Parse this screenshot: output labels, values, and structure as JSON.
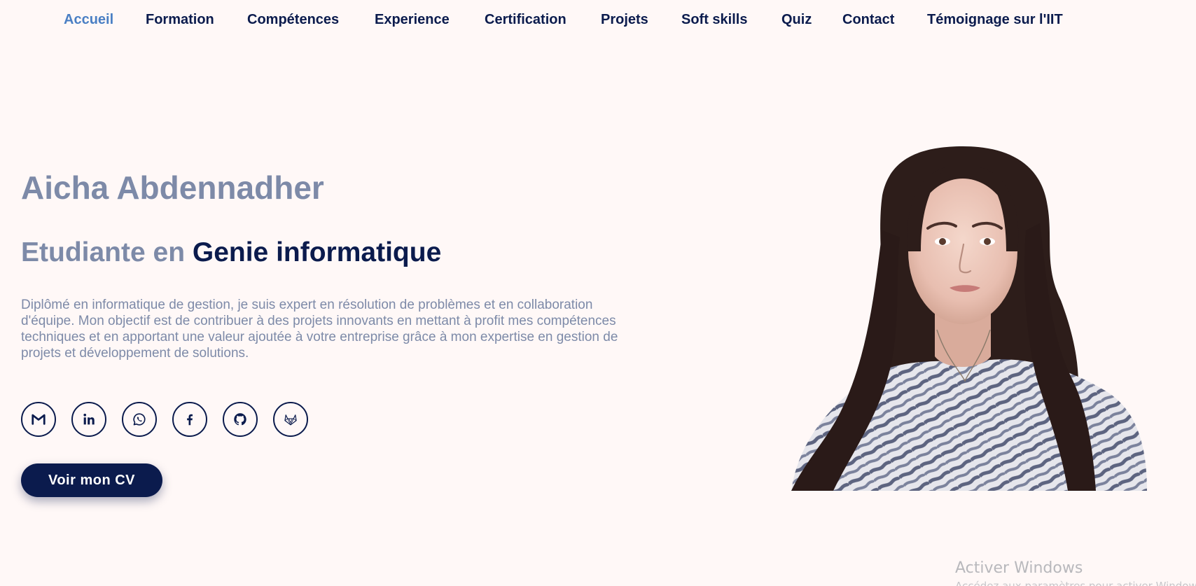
{
  "nav": {
    "items": [
      {
        "label": "Accueil",
        "active": true
      },
      {
        "label": "Formation"
      },
      {
        "label": "Compétences"
      },
      {
        "label": "Experience"
      },
      {
        "label": "Certification"
      },
      {
        "label": "Projets"
      },
      {
        "label": "Soft skills"
      },
      {
        "label": "Quiz"
      },
      {
        "label": "Contact"
      },
      {
        "label": "Témoignage sur l'IIT"
      }
    ]
  },
  "hero": {
    "name": "Aicha Abdennadher",
    "subtitle_prefix": "Etudiante en",
    "subtitle_field": "Genie informatique",
    "description": "Diplômé en informatique de gestion, je suis expert en résolution de problèmes et en collaboration d'équipe. Mon objectif est de contribuer à des projets innovants en mettant à profit mes compétences techniques et en apportant une valeur ajoutée à votre entreprise grâce à mon expertise en gestion de projets et développement de solutions.",
    "socials": [
      {
        "icon": "gmail-icon"
      },
      {
        "icon": "linkedin-icon"
      },
      {
        "icon": "whatsapp-icon"
      },
      {
        "icon": "facebook-icon"
      },
      {
        "icon": "github-icon"
      },
      {
        "icon": "gitlab-icon"
      }
    ],
    "cv_button": "Voir mon CV",
    "portrait": "portrait-photo"
  },
  "watermark": {
    "title": "Activer Windows",
    "subtitle": "Accédez aux paramètres pour activer Windows."
  },
  "colors": {
    "background": "#fff8f7",
    "navy": "#0b1b4d",
    "muted": "#7d8aa8",
    "active_link": "#4a7fc4"
  }
}
